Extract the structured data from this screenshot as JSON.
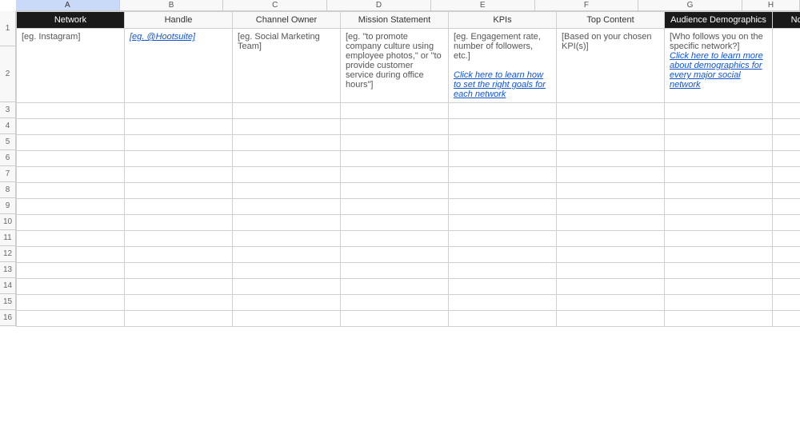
{
  "columns": {
    "letters": [
      "A",
      "B",
      "C",
      "D",
      "E",
      "F",
      "G",
      "H"
    ],
    "widths": [
      135,
      135,
      135,
      135,
      135,
      135,
      135,
      75
    ]
  },
  "headers": {
    "network": "Network",
    "handle": "Handle",
    "channel_owner": "Channel Owner",
    "mission_statement": "Mission Statement",
    "kpis": "KPIs",
    "top_content": "Top Content",
    "audience_demographics": "Audience Demographics",
    "notes": "Notes"
  },
  "example_row": {
    "network": "[eg. Instagram]",
    "handle_link": "[eg. @Hootsuite]",
    "channel_owner": "[eg. Social Marketing Team]",
    "mission_statement": "[eg. \"to promote company culture using employee photos,\" or \"to provide customer service during office hours\"]",
    "kpis_text": "[eg. Engagement rate, number of followers, etc.]",
    "kpis_link": "Click here to learn how to set the right goals for each network",
    "top_content": "[Based on your chosen KPI(s)]",
    "audience_text": "[Who follows you on the specific network?]",
    "audience_link": "Click here to learn more about demographics for every major social network",
    "notes": ""
  },
  "empty_rows": 14
}
